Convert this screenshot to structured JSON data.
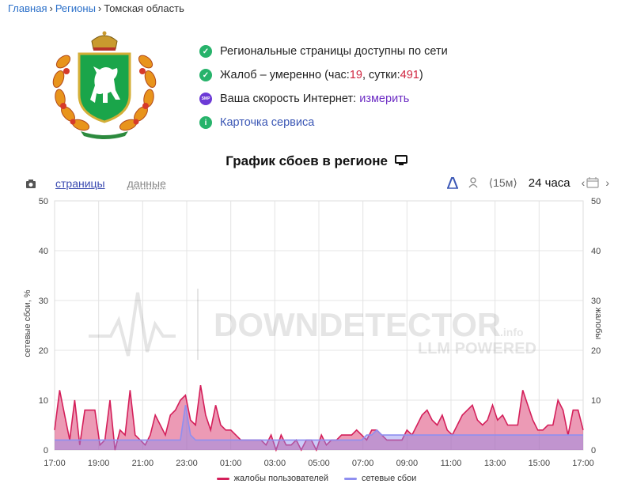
{
  "breadcrumb": {
    "home": "Главная",
    "regions": "Регионы",
    "current": "Томская область"
  },
  "status": {
    "pages_ok": "Региональные страницы доступны по сети",
    "complaints_prefix": "Жалоб – умеренно (час: ",
    "complaints_hour": "19",
    "complaints_mid": ", сутки: ",
    "complaints_day": "491",
    "complaints_suffix": ")",
    "speed_label": "Ваша скорость Интернет: ",
    "speed_link": "измерить",
    "speed_badge": "SMP",
    "service_card": "Карточка сервиса"
  },
  "chart_header": {
    "title": "График сбоев в регионе"
  },
  "tabs": {
    "pages": "страницы",
    "data": "данные"
  },
  "toolbar": {
    "interval": "⟨15м⟩",
    "period": "24 часа"
  },
  "watermark": {
    "main": "DOWNDETECTOR",
    "suffix": ".info",
    "sub": "LLM POWERED"
  },
  "colors": {
    "complaints": "#d41f5a",
    "outages": "#8f8ff0"
  },
  "chart_data": {
    "type": "area",
    "ylabel": "сетевые сбои, %",
    "ylabel_right": "жалобы",
    "ylim": [
      0,
      50
    ],
    "yticks": [
      0,
      10,
      20,
      30,
      40,
      50
    ],
    "x_ticks": [
      "17:00",
      "19:00",
      "21:00",
      "23:00",
      "01:00",
      "03:00",
      "05:00",
      "07:00",
      "09:00",
      "11:00",
      "13:00",
      "15:00",
      "17:00"
    ],
    "grid": true,
    "legend_position": "bottom",
    "series": [
      {
        "name": "жалобы пользователей",
        "values": [
          4,
          12,
          7,
          2,
          10,
          1,
          8,
          8,
          8,
          1,
          2,
          10,
          0,
          4,
          3,
          12,
          3,
          2,
          1,
          3,
          7,
          5,
          3,
          7,
          8,
          10,
          11,
          6,
          5,
          13,
          7,
          4,
          9,
          5,
          4,
          4,
          3,
          2,
          2,
          2,
          2,
          2,
          1,
          3,
          0,
          3,
          1,
          1,
          2,
          0,
          2,
          2,
          0,
          3,
          1,
          2,
          2,
          3,
          3,
          3,
          4,
          3,
          2,
          4,
          4,
          3,
          2,
          2,
          2,
          2,
          4,
          3,
          5,
          7,
          8,
          6,
          5,
          7,
          4,
          3,
          5,
          7,
          8,
          9,
          6,
          5,
          6,
          9,
          6,
          7,
          5,
          5,
          5,
          12,
          9,
          6,
          4,
          4,
          5,
          5,
          10,
          8,
          3,
          8,
          8,
          4
        ]
      },
      {
        "name": "сетевые сбои",
        "values": [
          2,
          2,
          2,
          2,
          2,
          2,
          2,
          2,
          2,
          2,
          2,
          2,
          2,
          2,
          2,
          2,
          2,
          2,
          2,
          2,
          2,
          2,
          2,
          2,
          2,
          2,
          9,
          3,
          2,
          2,
          2,
          2,
          2,
          2,
          2,
          2,
          2,
          2,
          2,
          2,
          2,
          2,
          2,
          2,
          2,
          2,
          2,
          2,
          2,
          2,
          2,
          2,
          2,
          2,
          2,
          2,
          2,
          2,
          2,
          2,
          2,
          2,
          3,
          3,
          4,
          3,
          3,
          3,
          3,
          3,
          3,
          3,
          3,
          3,
          3,
          3,
          3,
          3,
          3,
          3,
          3,
          3,
          3,
          3,
          3,
          3,
          3,
          3,
          3,
          3,
          3,
          3,
          3,
          3,
          3,
          3,
          3,
          3,
          3,
          3,
          3,
          3,
          3,
          3,
          3,
          3
        ]
      }
    ]
  }
}
